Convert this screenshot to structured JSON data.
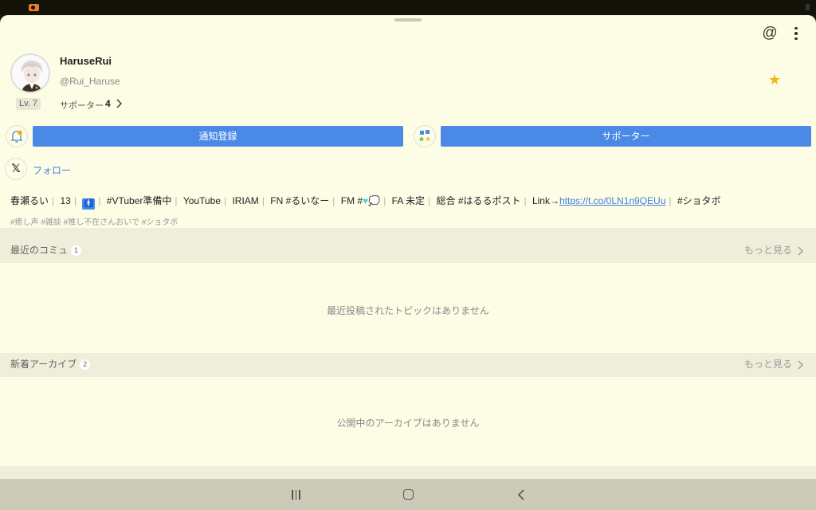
{
  "profile": {
    "name": "HaruseRui",
    "handle": "@Rui_Haruse",
    "level": "Lv. 7",
    "supporter_label": "サポーター",
    "supporter_count": "4"
  },
  "buttons": {
    "notify": "通知登録",
    "supporter": "サポーター",
    "follow": "フォロー"
  },
  "bio": {
    "parts": [
      "春瀬るい",
      "13",
      "🚹",
      "#VTuber準備中",
      "YouTube",
      "IRIAM",
      "FN #るいなー",
      "FM #",
      "FA 未定",
      "総合 #はるるポスト"
    ],
    "link_prefix": "Link→",
    "link_url": "https://t.co/0LN1n9QEUu",
    "tail_tag": "#ショタボ",
    "tags": "#癒し声 #雑談 #推し不在さんおいで #ショタボ"
  },
  "sections": {
    "communities": {
      "title": "最近のコミュ",
      "count": "1",
      "see_more": "もっと見る",
      "empty": "最近投稿されたトピックはありません"
    },
    "archives": {
      "title": "新着アーカイブ",
      "count": "2",
      "see_more": "もっと見る",
      "empty": "公開中のアーカイブはありません"
    }
  },
  "colors": {
    "accent": "#4a8ae6",
    "background": "#fdfde6",
    "section": "#eeeedb",
    "star": "#f5b51b"
  },
  "icons": [
    "record-icon",
    "at-icon",
    "more-vert-icon",
    "star-icon",
    "bell-icon",
    "supporter-icon",
    "x-logo-icon",
    "chevron-right-icon",
    "nav-recents-icon",
    "nav-home-icon",
    "nav-back-icon"
  ]
}
